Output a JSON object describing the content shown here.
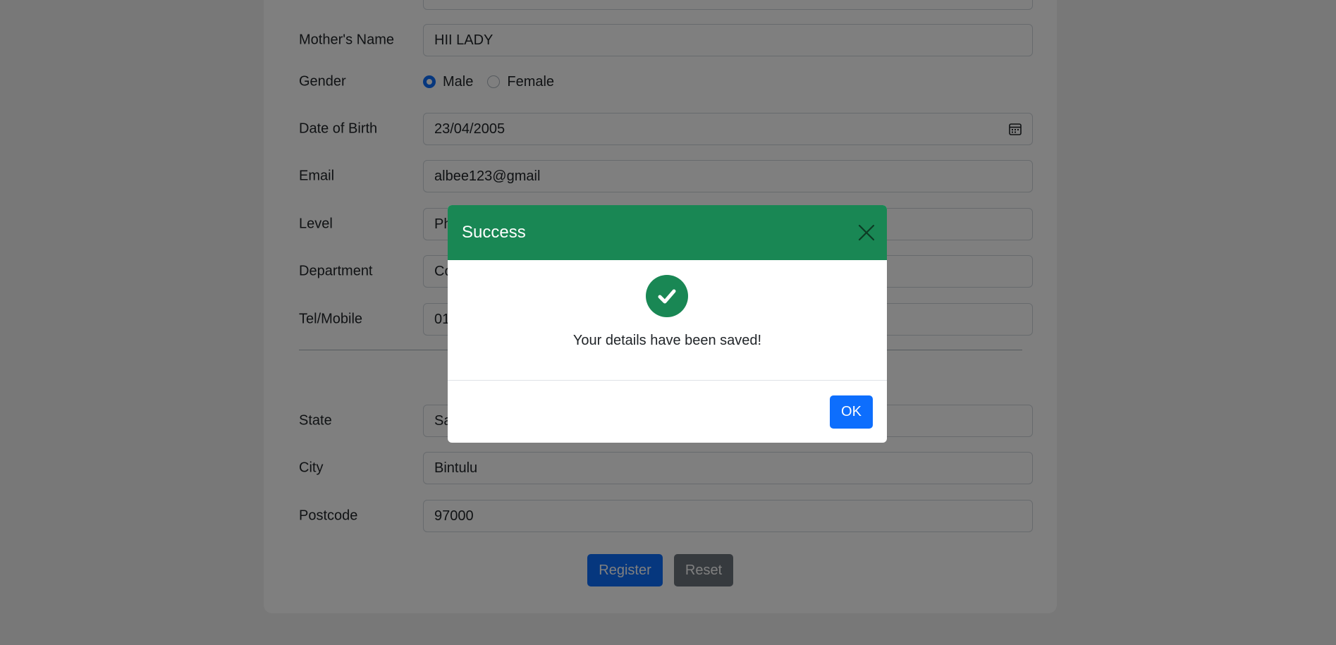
{
  "form": {
    "mothers_name": {
      "label": "Mother's Name",
      "value": "HII LADY"
    },
    "gender": {
      "label": "Gender",
      "options": [
        "Male",
        "Female"
      ],
      "selected": "Male"
    },
    "dob": {
      "label": "Date of Birth",
      "value": "23/04/2005"
    },
    "email": {
      "label": "Email",
      "value": "albee123@gmail"
    },
    "level": {
      "label": "Level",
      "value": "Ph"
    },
    "department": {
      "label": "Department",
      "value": "Co"
    },
    "tel": {
      "label": "Tel/Mobile",
      "value": "01"
    },
    "state": {
      "label": "State",
      "value": "Sa"
    },
    "city": {
      "label": "City",
      "value": "Bintulu"
    },
    "postcode": {
      "label": "Postcode",
      "value": "97000"
    },
    "register_label": "Register",
    "reset_label": "Reset"
  },
  "modal": {
    "title": "Success",
    "message": "Your details have been saved!",
    "ok_label": "OK",
    "icon": "check-circle-icon",
    "header_color": "#198754"
  },
  "colors": {
    "primary": "#0d6efd",
    "secondary": "#6c757d",
    "success": "#198754"
  }
}
